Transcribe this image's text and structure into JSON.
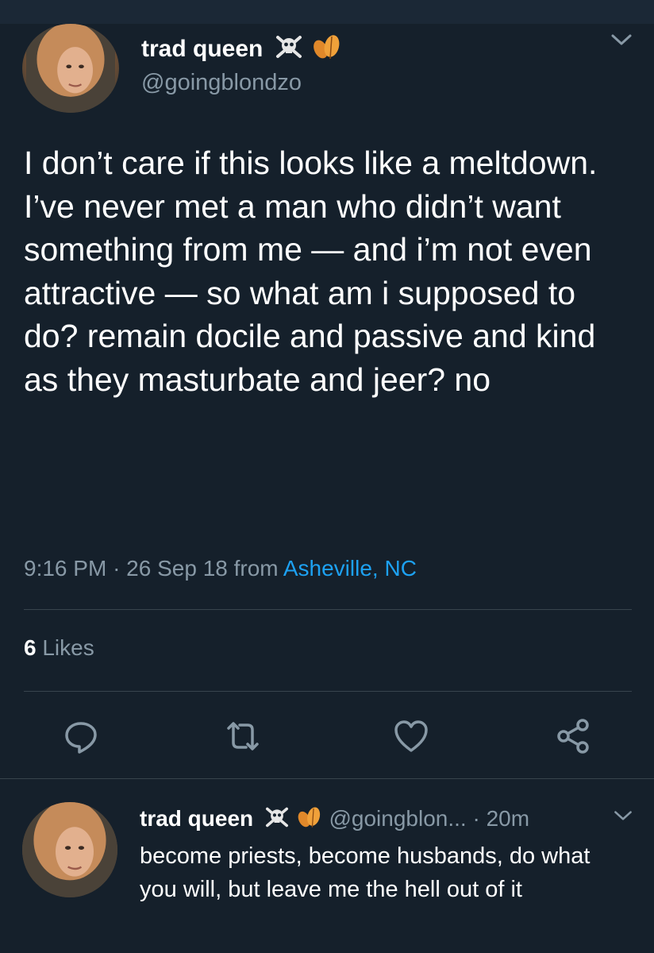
{
  "tweet": {
    "author_name": "trad queen",
    "author_handle": "@goingblondzo",
    "emoji": [
      "skull-and-crossbones",
      "leaves"
    ],
    "text": "I don’t care if this looks like a meltdown. I’ve never met a man who didn’t want something from me — and i’m not even attractive — so what am i supposed to do? remain docile and passive and kind as they masturbate and jeer? no",
    "time": "9:16 PM",
    "separator": "·",
    "date": "26 Sep 18",
    "from_label": "from",
    "location": "Asheville, NC",
    "likes_count": "6",
    "likes_label": "Likes"
  },
  "actions": [
    "reply-icon",
    "retweet-icon",
    "like-icon",
    "share-icon"
  ],
  "reply": {
    "author_name": "trad queen",
    "author_handle": "@goingblon...",
    "separator": "·",
    "time_ago": "20m",
    "text": "become priests, become husbands, do what you will, but leave me the hell out of it"
  },
  "colors": {
    "background": "#15202b",
    "text": "#ffffff",
    "muted": "#8899a6",
    "link": "#1da1f2",
    "divider": "#38444d"
  }
}
